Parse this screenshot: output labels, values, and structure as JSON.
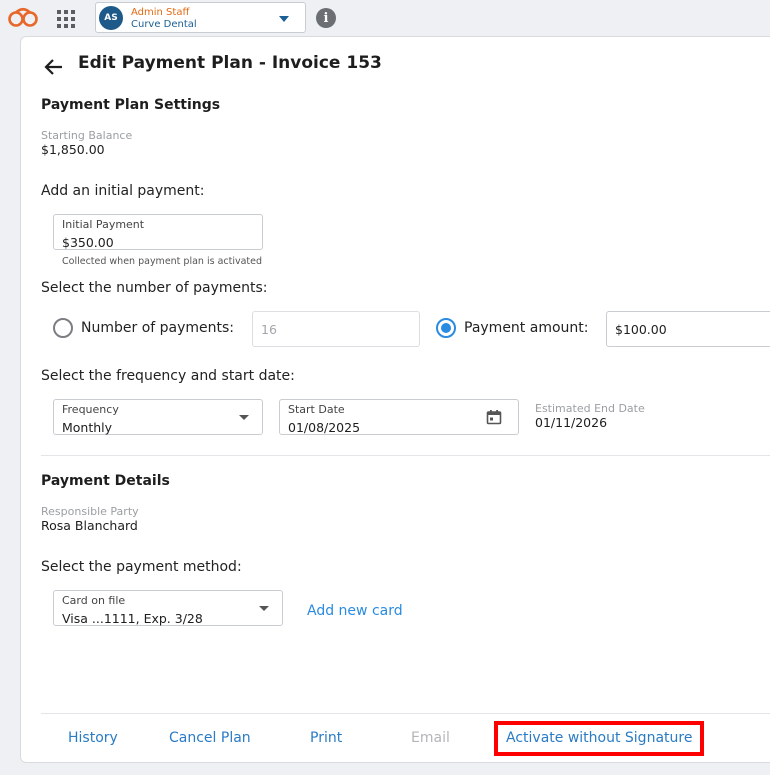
{
  "topbar": {
    "user_initials": "AS",
    "user_role": "Admin Staff",
    "practice": "Curve Dental",
    "icons": {
      "logo": "curve-logo-icon",
      "apps": "apps-grid-icon",
      "info": "info-icon"
    }
  },
  "page": {
    "title": "Edit Payment Plan - Invoice 153"
  },
  "settings": {
    "title": "Payment Plan Settings",
    "starting_balance_label": "Starting Balance",
    "starting_balance": "$1,850.00",
    "initial_payment_prompt": "Add an initial payment:",
    "initial_payment_label": "Initial Payment",
    "initial_payment_value": "$350.00",
    "initial_payment_helper": "Collected when payment plan is activated",
    "number_prompt": "Select the number of payments:",
    "number_of_payments_label": "Number of payments:",
    "number_of_payments_value": "16",
    "payment_amount_label": "Payment amount:",
    "payment_amount_value": "$100.00",
    "selected_option": "payment_amount",
    "frequency_prompt": "Select the frequency and start date:",
    "frequency_label": "Frequency",
    "frequency_value": "Monthly",
    "start_date_label": "Start Date",
    "start_date_value": "01/08/2025",
    "end_date_label": "Estimated End Date",
    "end_date_value": "01/11/2026"
  },
  "details": {
    "title": "Payment Details",
    "responsible_label": "Responsible Party",
    "responsible_value": "Rosa Blanchard",
    "method_prompt": "Select the payment method:",
    "card_label": "Card on file",
    "card_value": "Visa ...1111, Exp. 3/28",
    "add_card": "Add new card"
  },
  "footer": {
    "history": "History",
    "cancel_plan": "Cancel Plan",
    "print": "Print",
    "email": "Email",
    "activate": "Activate without Signature"
  },
  "colors": {
    "accent": "#2a8be0",
    "highlight": "#ff0000",
    "brand_orange": "#e36a12",
    "avatar": "#1d5a8a"
  }
}
